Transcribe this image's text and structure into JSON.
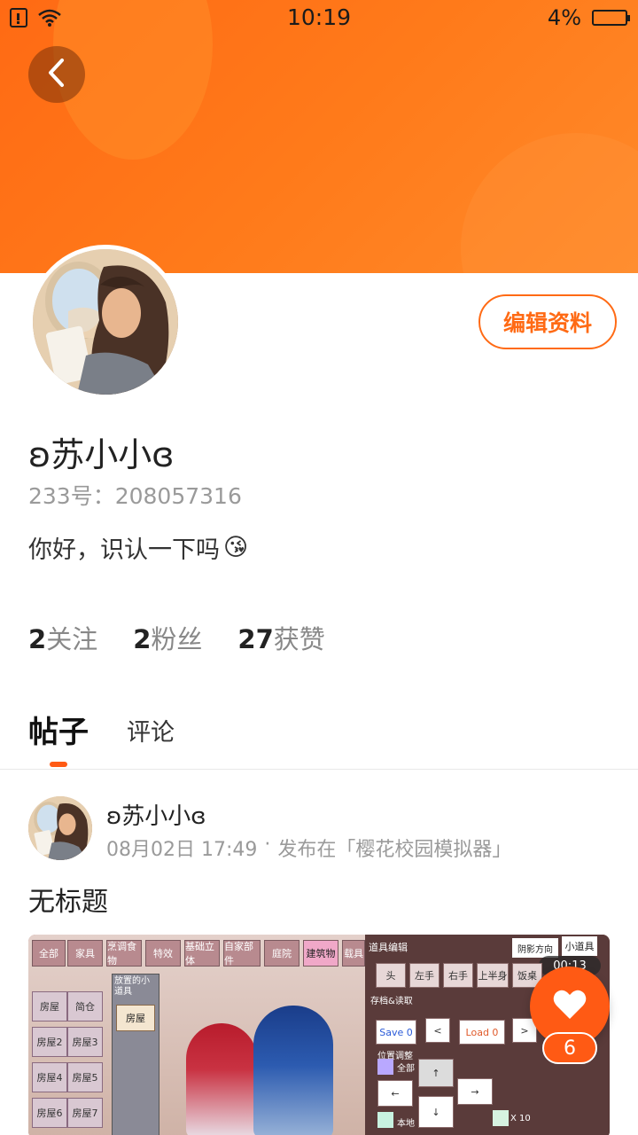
{
  "status_bar": {
    "time": "10:19",
    "battery_percent": "4%",
    "icons": [
      "sim-icon",
      "wifi-icon",
      "battery-icon"
    ]
  },
  "colors": {
    "accent": "#ff6a14",
    "header_gradient_start": "#ff6a14",
    "header_gradient_end": "#ff8a2a"
  },
  "profile": {
    "username": "ʚ苏小小ɞ",
    "uid_label": "233号：",
    "uid_value": "208057316",
    "bio": "你好，识认一下吗",
    "bio_emoji": "😘",
    "edit_label": "编辑资料"
  },
  "stats": [
    {
      "num": "2",
      "label": "关注"
    },
    {
      "num": "2",
      "label": "粉丝"
    },
    {
      "num": "27",
      "label": "获赞"
    }
  ],
  "tabs": {
    "posts": "帖子",
    "comments": "评论",
    "active": "posts"
  },
  "post": {
    "author": "ʚ苏小小ɞ",
    "date": "08月02日 17:49",
    "separator": "·",
    "published_in": "发布在「樱花校园模拟器」",
    "title": "无标题",
    "image": {
      "top_tabs": [
        "全部",
        "家具",
        "烹调食物",
        "特效",
        "基础立体",
        "自家部件",
        "庭院",
        "建筑物",
        "载具"
      ],
      "left_cells": [
        "房屋",
        "简仓",
        "房屋2",
        "房屋3",
        "房屋4",
        "房屋5",
        "房屋6",
        "房屋7"
      ],
      "placed_label": "放置的小道具",
      "placed_item": "房屋",
      "right_title": "道具编辑",
      "right_buttons": [
        "头",
        "左手",
        "右手",
        "上半身",
        "饭桌"
      ],
      "save_label": "Save 0",
      "load_label": "Load 0",
      "save_section": "存档&读取",
      "position_section": "位置调整",
      "all_label": "全部",
      "local_label": "本地",
      "multiplier": "X 10",
      "shadow_label": "阴影方向",
      "props_label": "小道具",
      "timer": "00:13"
    }
  },
  "like": {
    "count": "6"
  }
}
